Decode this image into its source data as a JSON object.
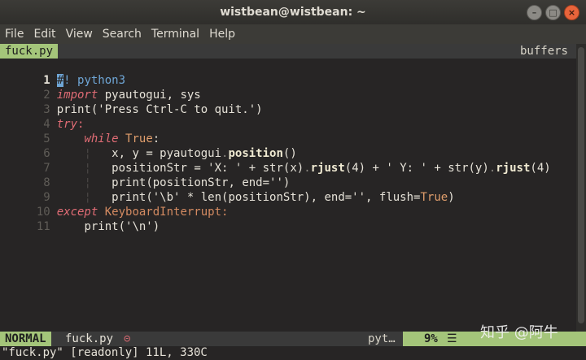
{
  "window": {
    "title": "wistbean@wistbean: ~"
  },
  "menu": [
    "File",
    "Edit",
    "View",
    "Search",
    "Terminal",
    "Help"
  ],
  "tabline": {
    "active_tab": "fuck.py",
    "buffers_label": "buffers"
  },
  "editor": {
    "lines": [
      {
        "n": "1"
      },
      {
        "n": "2"
      },
      {
        "n": "3"
      },
      {
        "n": "4"
      },
      {
        "n": "5"
      },
      {
        "n": "6"
      },
      {
        "n": "7"
      },
      {
        "n": "8"
      },
      {
        "n": "9"
      },
      {
        "n": "10"
      },
      {
        "n": "11"
      }
    ],
    "tokens": {
      "l1_cursor": "#",
      "l1_rest": "! python3",
      "l2_kw": "import",
      "l2_rest": " pyautogui, sys",
      "l3": "print('Press Ctrl-C to quit.')",
      "l4_kw": "try",
      "l4_colon": ":",
      "l5_kw": "while",
      "l5_true": "True",
      "l5_colon": ":",
      "l6_a": "x, y = pyautogui",
      "l6_dot": ".",
      "l6_fn": "position",
      "l6_b": "()",
      "l7_a": "positionStr = 'X: ' + str(x)",
      "l7_dot1": ".",
      "l7_fn1": "rjust",
      "l7_b": "(4) + ' Y: ' + str(y)",
      "l7_dot2": ".",
      "l7_fn2": "rjust",
      "l7_c": "(4)",
      "l8": "print(positionStr, end='')",
      "l9_a": "print('\\b' * len(positionStr), end='', flush=",
      "l9_true": "True",
      "l9_b": ")",
      "l10_kw": "except",
      "l10_rest": " KeyboardInterrupt:",
      "l11": "print('\\n')"
    }
  },
  "statusline": {
    "mode": "NORMAL",
    "file": "fuck.py",
    "icon": "⊝",
    "filetype": "pyt…",
    "percent": "9%",
    "lines_icon": "☰"
  },
  "cmdline": "\"fuck.py\" [readonly] 11L, 330C",
  "watermark": "知乎 @阿牛",
  "colors": {
    "accent_green": "#a4c57a",
    "keyword": "#e06c75",
    "comment": "#6fa6d6"
  }
}
